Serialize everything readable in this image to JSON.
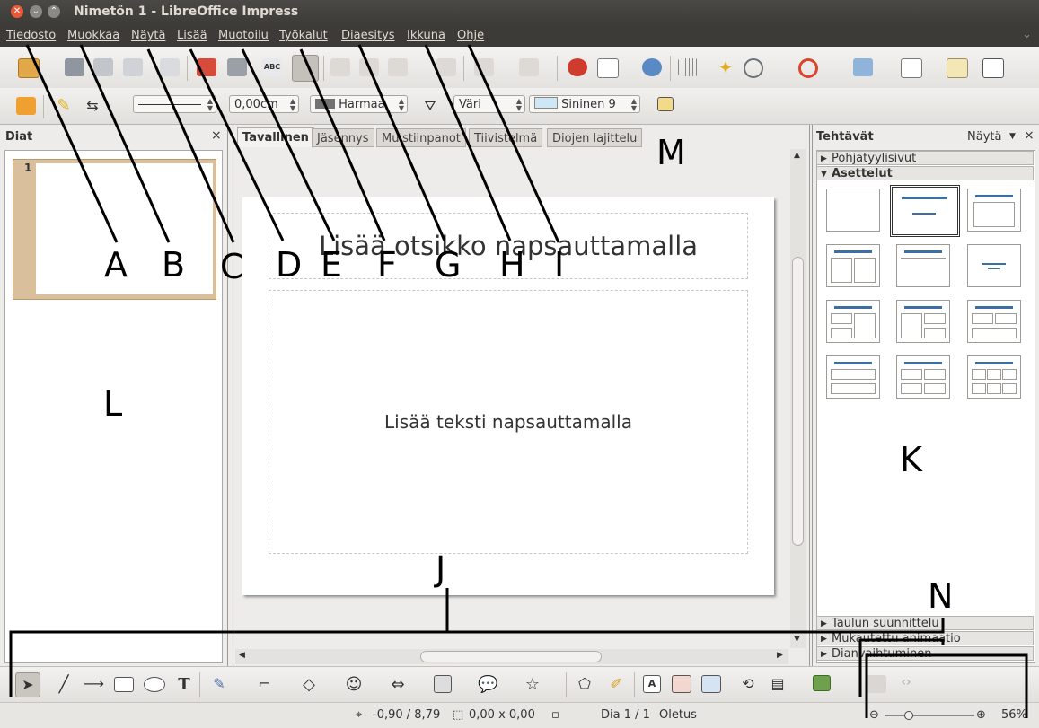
{
  "window": {
    "title": "Nimetön 1 - LibreOffice Impress"
  },
  "menu": [
    "Tiedosto",
    "Muokkaa",
    "Näytä",
    "Lisää",
    "Muotoilu",
    "Työkalut",
    "Diaesitys",
    "Ikkuna",
    "Ohje"
  ],
  "toolbar2": {
    "line_width": "0,00cm",
    "line_color": "Harmaa",
    "fill_type": "Väri",
    "fill_color": "Sininen 9"
  },
  "slides_panel": {
    "title": "Diat",
    "close": "×",
    "thumb_number": "1"
  },
  "view_tabs": [
    "Tavallinen",
    "Jäsennys",
    "Muistiinpanot",
    "Tiivistelmä",
    "Diojen lajittelu"
  ],
  "slide": {
    "title_placeholder": "Lisää otsikko napsauttamalla",
    "body_placeholder": "Lisää teksti napsauttamalla"
  },
  "tasks_panel": {
    "title": "Tehtävät",
    "view_menu": "Näytä",
    "close": "×",
    "sections_top": [
      "Pohjatyylisivut",
      "Asettelut"
    ],
    "sections_bottom": [
      "Taulun suunnittelu",
      "Mukautettu animaatio",
      "Dianvaihtuminen"
    ]
  },
  "status": {
    "position": "-0,90 / 8,79",
    "size": "0,00 x 0,00",
    "slide": "Dia 1 / 1",
    "master": "Oletus",
    "zoom": "56%"
  },
  "annotations": [
    "A",
    "B",
    "C",
    "D",
    "E",
    "F",
    "G",
    "H",
    "I",
    "J",
    "K",
    "L",
    "M",
    "N"
  ],
  "colors": {
    "titlebar": "#3c3b37",
    "accent": "#3c6fa4",
    "close_btn": "#e8593a"
  }
}
